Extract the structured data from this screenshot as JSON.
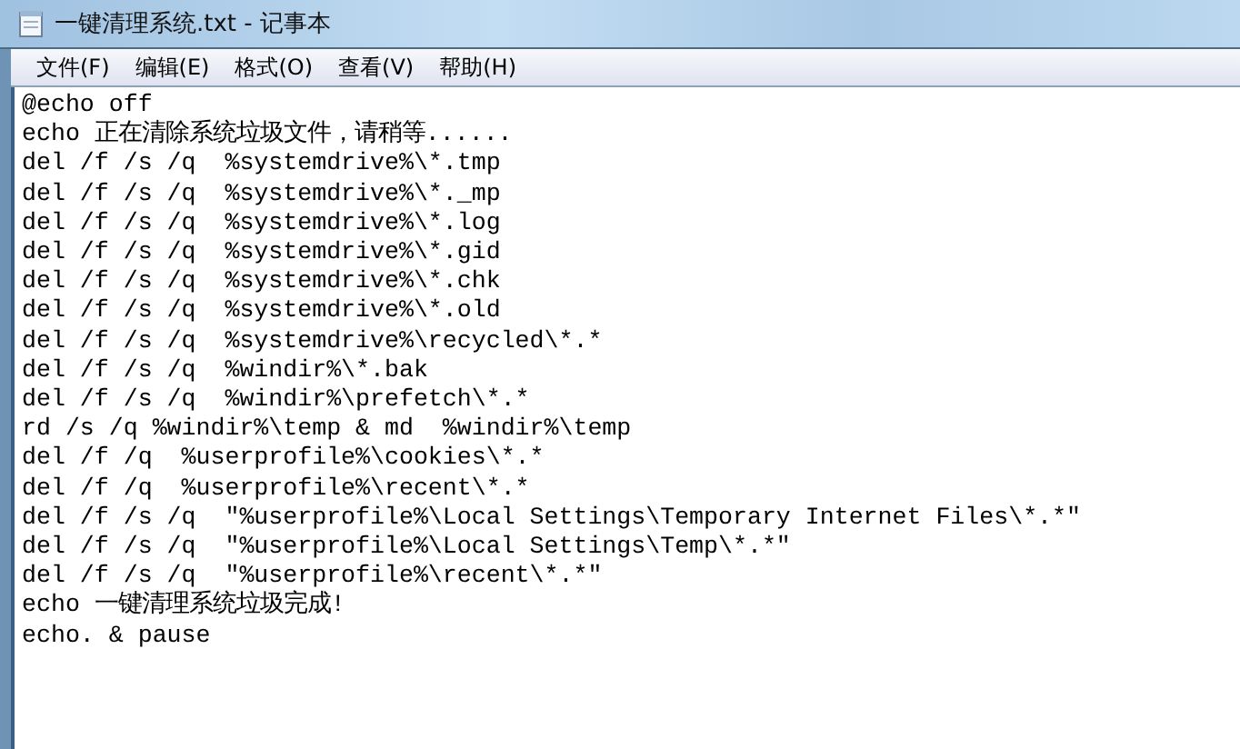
{
  "window": {
    "title": "一键清理系统.txt - 记事本"
  },
  "menu": [
    "文件(F)",
    "编辑(E)",
    "格式(O)",
    "查看(V)",
    "帮助(H)"
  ],
  "lines": [
    "@echo off",
    "echo 正在清除系统垃圾文件，请稍等......",
    "del /f /s /q  %systemdrive%\\*.tmp",
    "del /f /s /q  %systemdrive%\\*._mp",
    "del /f /s /q  %systemdrive%\\*.log",
    "del /f /s /q  %systemdrive%\\*.gid",
    "del /f /s /q  %systemdrive%\\*.chk",
    "del /f /s /q  %systemdrive%\\*.old",
    "del /f /s /q  %systemdrive%\\recycled\\*.*",
    "del /f /s /q  %windir%\\*.bak",
    "del /f /s /q  %windir%\\prefetch\\*.*",
    "rd /s /q %windir%\\temp & md  %windir%\\temp",
    "del /f /q  %userprofile%\\cookies\\*.*",
    "del /f /q  %userprofile%\\recent\\*.*",
    "del /f /s /q  \"%userprofile%\\Local Settings\\Temporary Internet Files\\*.*\"",
    "del /f /s /q  \"%userprofile%\\Local Settings\\Temp\\*.*\"",
    "del /f /s /q  \"%userprofile%\\recent\\*.*\"",
    "echo 一键清理系统垃圾完成!",
    "echo. & pause"
  ]
}
